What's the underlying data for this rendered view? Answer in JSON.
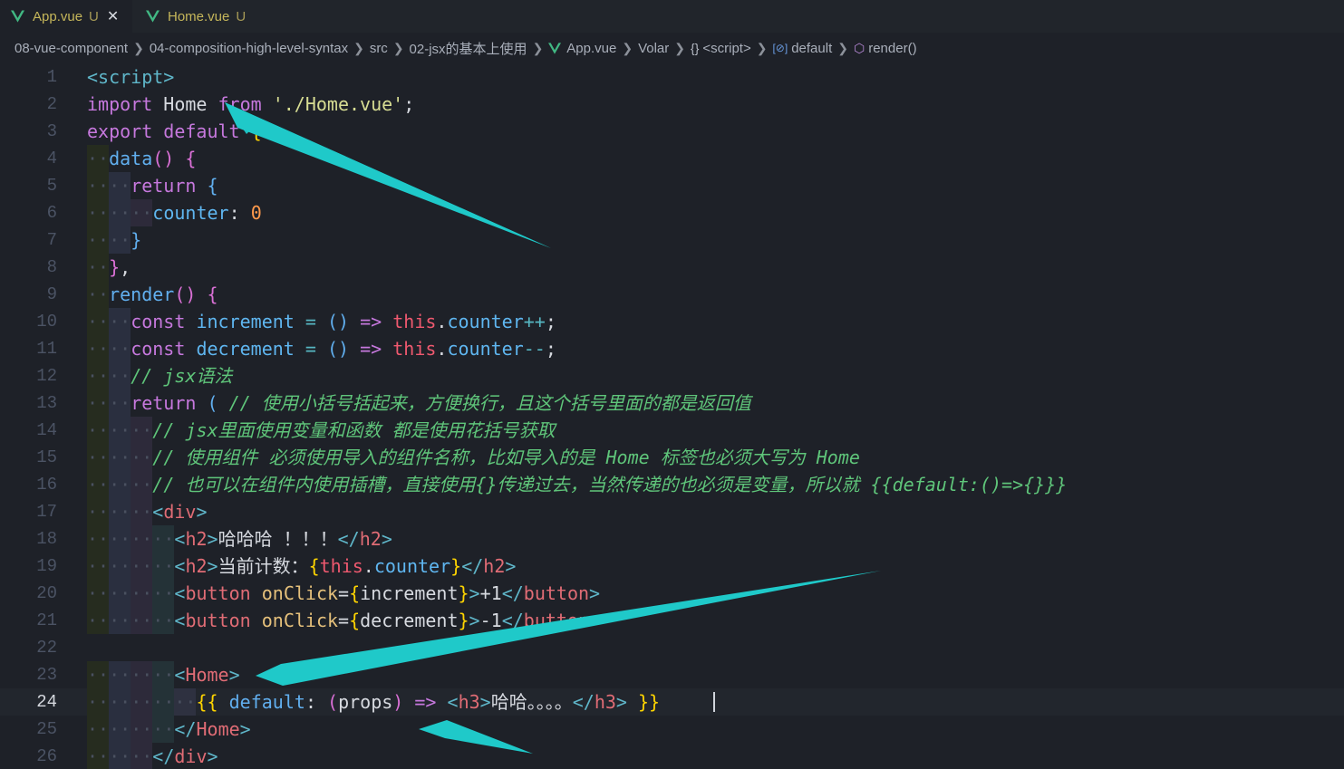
{
  "tabs": [
    {
      "name": "App.vue",
      "status": "U",
      "active": true,
      "close": "✕"
    },
    {
      "name": "Home.vue",
      "status": "U",
      "active": false
    }
  ],
  "breadcrumb": [
    "08-vue-component",
    "04-composition-high-level-syntax",
    "src",
    "02-jsx的基本上使用",
    "App.vue",
    "Volar",
    "<script>",
    "default",
    "render()"
  ],
  "breadcrumb_icons": {
    "braces": "{}",
    "default": "[⊘]",
    "render": "⬡"
  },
  "editor": {
    "current_line": 24,
    "lines": [
      {
        "n": "1"
      },
      {
        "n": "2"
      },
      {
        "n": "3"
      },
      {
        "n": "4"
      },
      {
        "n": "5"
      },
      {
        "n": "6"
      },
      {
        "n": "7"
      },
      {
        "n": "8"
      },
      {
        "n": "9"
      },
      {
        "n": "10"
      },
      {
        "n": "11"
      },
      {
        "n": "12"
      },
      {
        "n": "13"
      },
      {
        "n": "14"
      },
      {
        "n": "15"
      },
      {
        "n": "16"
      },
      {
        "n": "17"
      },
      {
        "n": "18"
      },
      {
        "n": "19"
      },
      {
        "n": "20"
      },
      {
        "n": "21"
      },
      {
        "n": "22"
      },
      {
        "n": "23"
      },
      {
        "n": "24"
      },
      {
        "n": "25"
      },
      {
        "n": "26"
      }
    ],
    "tokens": {
      "l1": [
        "<script>"
      ],
      "l2": [
        "import",
        " Home ",
        "from",
        " ",
        "'./Home.vue'",
        ";"
      ],
      "l3": [
        "export",
        " ",
        "default",
        " ",
        "{"
      ],
      "l4": [
        "data",
        "()",
        " ",
        "{"
      ],
      "l5": [
        "return",
        " ",
        "{"
      ],
      "l6": [
        "counter",
        ":",
        " ",
        "0"
      ],
      "l7": [
        "}"
      ],
      "l8": [
        "}",
        ","
      ],
      "l9": [
        "render",
        "()",
        " ",
        "{"
      ],
      "l10": [
        "const",
        " ",
        "increment",
        " ",
        "=",
        " ",
        "()",
        " ",
        "=>",
        " ",
        "this",
        ".",
        "counter",
        "++",
        ";"
      ],
      "l11": [
        "const",
        " ",
        "decrement",
        " ",
        "=",
        " ",
        "()",
        " ",
        "=>",
        " ",
        "this",
        ".",
        "counter",
        "--",
        ";"
      ],
      "l12": [
        "// jsx语法"
      ],
      "l13": [
        "return",
        " ",
        "(",
        " ",
        "// 使用小括号括起来，方便换行，且这个括号里面的都是返回值"
      ],
      "l14": [
        "// jsx里面使用变量和函数 都是使用花括号获取"
      ],
      "l15": [
        "// 使用组件 必须使用导入的组件名称，比如导入的是 Home 标签也必须大写为 Home"
      ],
      "l16": [
        "// 也可以在组件内使用插槽，直接使用{}传递过去，当然传递的也必须是变量，所以就 {{default:()=>{}}}"
      ],
      "l17": [
        "<",
        "div",
        ">"
      ],
      "l18": [
        "<",
        "h2",
        ">",
        "哈哈哈 ！！！",
        "</",
        "h2",
        ">"
      ],
      "l19": [
        "<",
        "h2",
        ">",
        "当前计数：",
        "{",
        "this",
        ".",
        "counter",
        "}",
        "</",
        "h2",
        ">"
      ],
      "l20": [
        "<",
        "button",
        " ",
        "onClick",
        "=",
        "{",
        "increment",
        "}",
        ">",
        "+1",
        "</",
        "button",
        ">"
      ],
      "l21": [
        "<",
        "button",
        " ",
        "onClick",
        "=",
        "{",
        "decrement",
        "}",
        ">",
        "-1",
        "</",
        "button",
        ">"
      ],
      "l22": [],
      "l23": [
        "<",
        "Home",
        ">"
      ],
      "l24": [
        "{{",
        " ",
        "default",
        ":",
        " ",
        "(",
        "props",
        ")",
        " ",
        "=>",
        " ",
        "<",
        "h3",
        ">",
        "哈哈。。。。",
        "</",
        "h3",
        ">",
        " ",
        "}}"
      ],
      "l25": [
        "</",
        "Home",
        ">"
      ],
      "l26": [
        "</",
        "div",
        ">"
      ]
    }
  },
  "colors": {
    "background": "#1e2128",
    "tabbar": "#21252b",
    "annotation_arrow": "#1fc9c9",
    "comment": "#5fc57a",
    "keyword": "#c678dd",
    "tag": "#e06c75"
  }
}
